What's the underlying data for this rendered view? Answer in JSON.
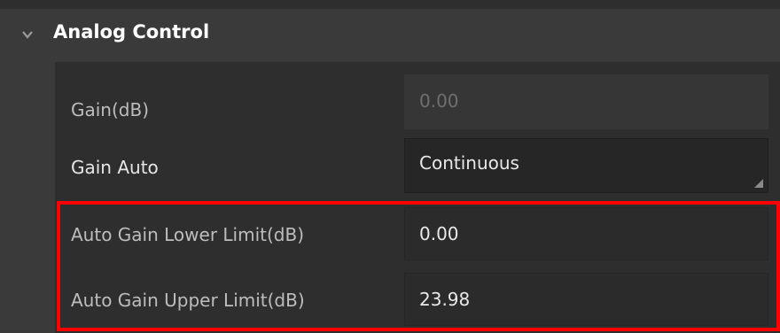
{
  "section": {
    "title": "Analog Control",
    "icon": "chevron-down-icon"
  },
  "properties": [
    {
      "label": "Gain(dB)",
      "value": "0.00",
      "state": "disabled"
    },
    {
      "label": "Gain Auto",
      "value": "Continuous",
      "state": "dropdown"
    },
    {
      "label": "Auto Gain Lower Limit(dB)",
      "value": "0.00",
      "state": "editable"
    },
    {
      "label": "Auto Gain Upper Limit(dB)",
      "value": "23.98",
      "state": "editable"
    }
  ],
  "highlight": {
    "color": "#ff0000",
    "covers": [
      "Auto Gain Lower Limit(dB)",
      "Auto Gain Upper Limit(dB)"
    ]
  },
  "colors": {
    "panel_background": "#2e2e2e",
    "header_background": "#3a3a3a",
    "field_background": "#2b2b2b",
    "disabled_text": "#6f6f6f",
    "label_text": "#bdbdbd",
    "bright_text": "#ffffff"
  }
}
